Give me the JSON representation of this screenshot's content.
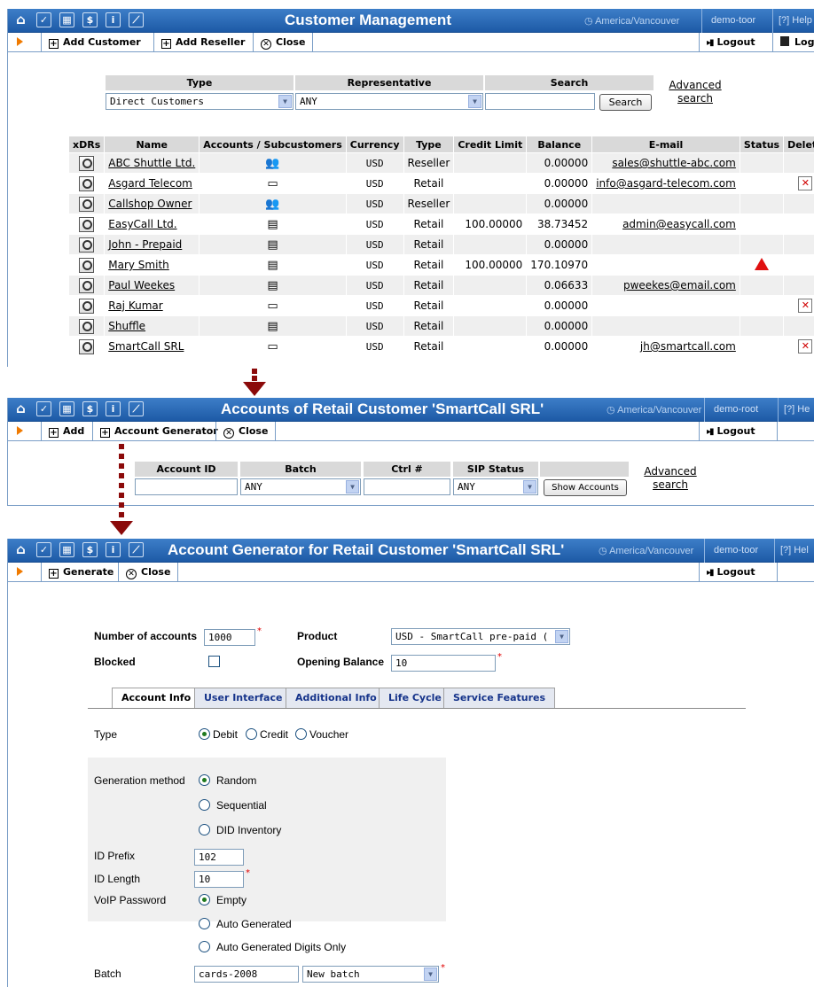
{
  "panel1": {
    "title": "Customer Management",
    "timezone": "America/Vancouver",
    "user": "demo-toor",
    "help": "Help",
    "toolbar": {
      "add_customer": "Add Customer",
      "add_reseller": "Add Reseller",
      "close": "Close",
      "logout": "Logout",
      "log": "Log"
    },
    "filter": {
      "type_label": "Type",
      "type_value": "Direct Customers",
      "rep_label": "Representative",
      "rep_value": "ANY",
      "search_label": "Search",
      "search_value": "",
      "search_button": "Search",
      "advanced_1": "Advanced",
      "advanced_2": "search"
    },
    "columns": [
      "xDRs",
      "Name",
      "Accounts / Subcustomers",
      "Currency",
      "Type",
      "Credit Limit",
      "Balance",
      "E-mail",
      "Status",
      "Delete"
    ],
    "rows": [
      {
        "name": "ABC Shuttle Ltd.",
        "acc": "subcustomers",
        "currency": "USD",
        "type": "Reseller",
        "credit": "",
        "balance": "0.00000",
        "email": "sales@shuttle-abc.com",
        "status": "",
        "delete": false
      },
      {
        "name": "Asgard Telecom",
        "acc": "account",
        "currency": "USD",
        "type": "Retail",
        "credit": "",
        "balance": "0.00000",
        "email": "info@asgard-telecom.com",
        "status": "",
        "delete": true
      },
      {
        "name": "Callshop Owner",
        "acc": "subcustomers",
        "currency": "USD",
        "type": "Reseller",
        "credit": "",
        "balance": "0.00000",
        "email": "",
        "status": "",
        "delete": false
      },
      {
        "name": "EasyCall Ltd.",
        "acc": "accounts",
        "currency": "USD",
        "type": "Retail",
        "credit": "100.00000",
        "balance": "38.73452",
        "email": "admin@easycall.com",
        "status": "",
        "delete": false
      },
      {
        "name": "John - Prepaid",
        "acc": "accounts",
        "currency": "USD",
        "type": "Retail",
        "credit": "",
        "balance": "0.00000",
        "email": "",
        "status": "",
        "delete": false
      },
      {
        "name": "Mary Smith",
        "acc": "accounts",
        "currency": "USD",
        "type": "Retail",
        "credit": "100.00000",
        "balance": "170.10970",
        "email": "",
        "status": "warning",
        "delete": false
      },
      {
        "name": "Paul Weekes",
        "acc": "accounts",
        "currency": "USD",
        "type": "Retail",
        "credit": "",
        "balance": "0.06633",
        "email": "pweekes@email.com",
        "status": "",
        "delete": false
      },
      {
        "name": "Raj Kumar",
        "acc": "account",
        "currency": "USD",
        "type": "Retail",
        "credit": "",
        "balance": "0.00000",
        "email": "",
        "status": "",
        "delete": true
      },
      {
        "name": "Shuffle",
        "acc": "accounts",
        "currency": "USD",
        "type": "Retail",
        "credit": "",
        "balance": "0.00000",
        "email": "",
        "status": "",
        "delete": false
      },
      {
        "name": "SmartCall SRL",
        "acc": "account",
        "currency": "USD",
        "type": "Retail",
        "credit": "",
        "balance": "0.00000",
        "email": "jh@smartcall.com",
        "status": "",
        "delete": true
      }
    ]
  },
  "panel2": {
    "title": "Accounts of Retail Customer 'SmartCall SRL'",
    "timezone": "America/Vancouver",
    "user": "demo-root",
    "help": "He",
    "toolbar": {
      "add": "Add",
      "account_generator": "Account Generator",
      "close": "Close",
      "logout": "Logout"
    },
    "filter": {
      "account_id_label": "Account ID",
      "account_id_value": "",
      "batch_label": "Batch",
      "batch_value": "ANY",
      "ctrl_label": "Ctrl #",
      "ctrl_value": "",
      "sip_label": "SIP Status",
      "sip_value": "ANY",
      "show_button": "Show Accounts",
      "advanced_1": "Advanced",
      "advanced_2": "search"
    }
  },
  "panel3": {
    "title": "Account Generator for Retail Customer 'SmartCall SRL'",
    "timezone": "America/Vancouver",
    "user": "demo-toor",
    "help": "Hel",
    "toolbar": {
      "generate": "Generate",
      "close": "Close",
      "logout": "Logout"
    },
    "form": {
      "num_accounts_label": "Number of accounts",
      "num_accounts_value": "1000",
      "product_label": "Product",
      "product_value": "USD - SmartCall pre-paid (",
      "blocked_label": "Blocked",
      "opening_balance_label": "Opening Balance",
      "opening_balance_value": "10"
    },
    "tabs": [
      "Account Info",
      "User Interface",
      "Additional Info",
      "Life Cycle",
      "Service Features"
    ],
    "account_info": {
      "type_label": "Type",
      "type_options": [
        "Debit",
        "Credit",
        "Voucher"
      ],
      "gen_method_label": "Generation method",
      "gen_method_options": [
        "Random",
        "Sequential",
        "DID Inventory"
      ],
      "id_prefix_label": "ID Prefix",
      "id_prefix_value": "102",
      "id_length_label": "ID Length",
      "id_length_value": "10",
      "voip_password_label": "VoIP Password",
      "voip_password_options": [
        "Empty",
        "Auto Generated",
        "Auto Generated Digits Only"
      ],
      "batch_label": "Batch",
      "batch_value": "cards-2008",
      "batch_select": "New batch"
    }
  },
  "colors": {
    "titlebar": "#2a66b4",
    "toolbar_arrow": "#f07a00",
    "flow_arrow": "#8b0a0a",
    "required": "#e00000",
    "header_bg": "#d9d9d9"
  }
}
